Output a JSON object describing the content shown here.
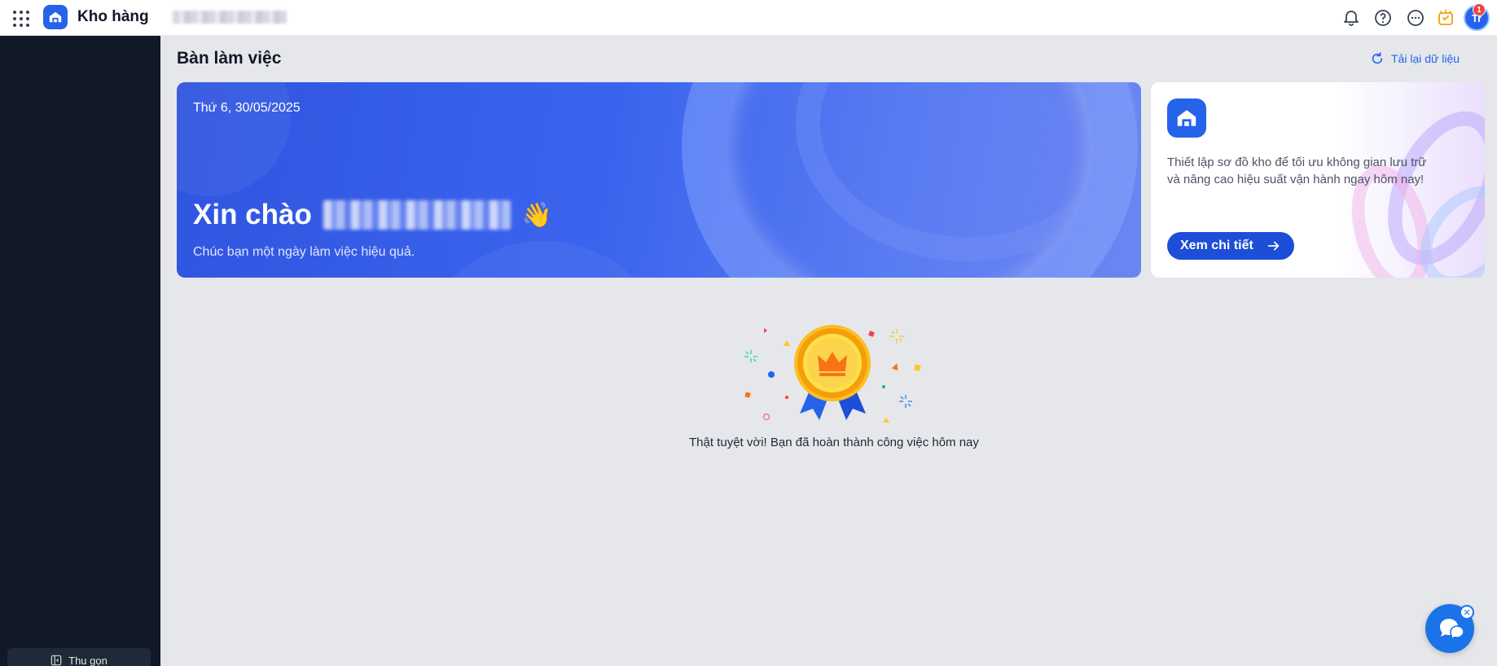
{
  "header": {
    "app_title": "Kho hàng",
    "notification_count": "1",
    "avatar_initials": "Tr",
    "icons": [
      "apps-grid-icon",
      "bell-icon",
      "help-icon",
      "more-icon",
      "lightbulb-icon"
    ]
  },
  "sidebar": {
    "collapse_label": "Thu gọn"
  },
  "main": {
    "page_title": "Bàn làm việc",
    "reload_label": "Tải lại dữ liệu",
    "greeting": {
      "date": "Thứ 6, 30/05/2025",
      "hello": "Xin chào",
      "wave_emoji": "👋",
      "subtitle": "Chúc bạn một ngày làm việc hiệu quả."
    },
    "promo": {
      "text": "Thiết lập sơ đồ kho để tối ưu không gian lưu trữ và nâng cao hiệu suất vận hành ngay hôm nay!",
      "button_label": "Xem chi tiết"
    },
    "empty_state": {
      "message": "Thật tuyệt vời! Bạn đã hoàn thành công việc hôm nay"
    }
  },
  "colors": {
    "brand": "#2563eb",
    "sidebar": "#111827",
    "background": "#e5e7eb"
  }
}
